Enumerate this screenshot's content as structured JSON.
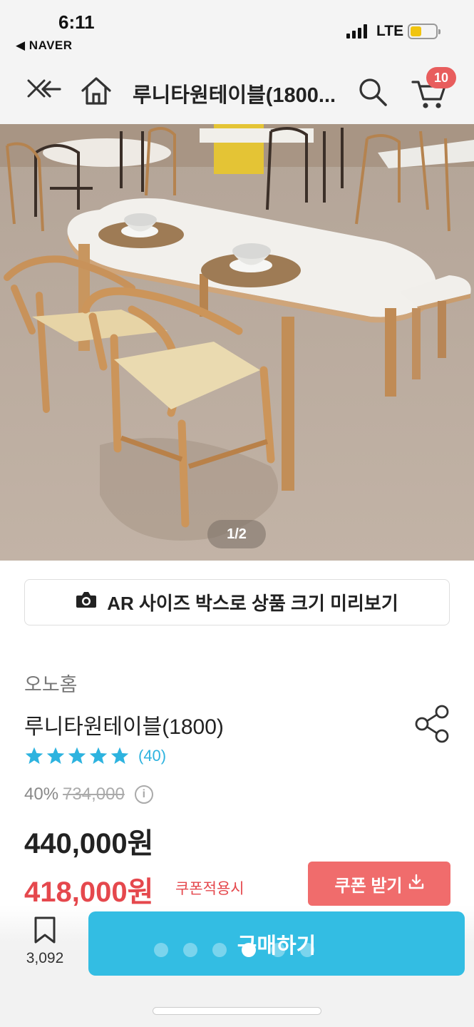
{
  "status_bar": {
    "time": "6:11",
    "back_app": "◀ NAVER",
    "network": "LTE",
    "battery_level": 0.45
  },
  "nav": {
    "title": "루니타원테이블(1800...",
    "cart_count": "10"
  },
  "gallery": {
    "counter": "1/2"
  },
  "ar_button": {
    "label": "AR 사이즈 박스로 상품 크기 미리보기"
  },
  "product": {
    "brand": "오노홈",
    "name": "루니타원테이블(1800)",
    "rating": 5,
    "review_count": "(40)",
    "discount": "40%",
    "original_price": "734,000",
    "sale_price": "440,000원",
    "coupon_price": "418,000원",
    "coupon_note": "쿠폰적용시",
    "coupon_button": "쿠폰 받기"
  },
  "bottom": {
    "bookmark_count": "3,092",
    "buy_label": "구매하기"
  },
  "colors": {
    "accent": "#33bde3",
    "coupon": "#e5484d",
    "badge": "#e85d5d",
    "star": "#2db3df"
  }
}
